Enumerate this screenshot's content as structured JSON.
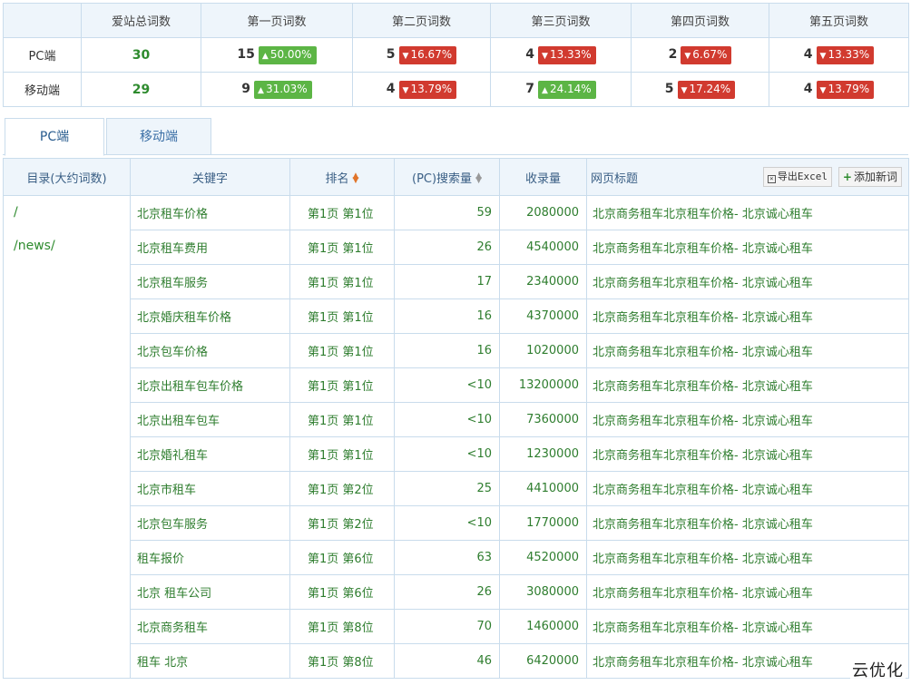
{
  "summary": {
    "headers": [
      "",
      "爱站总词数",
      "第一页词数",
      "第二页词数",
      "第三页词数",
      "第四页词数",
      "第五页词数"
    ],
    "rows": [
      {
        "label": "PC端",
        "total": "30",
        "pages": [
          {
            "count": "15",
            "pct": "50.00%",
            "dir": "up"
          },
          {
            "count": "5",
            "pct": "16.67%",
            "dir": "down"
          },
          {
            "count": "4",
            "pct": "13.33%",
            "dir": "down"
          },
          {
            "count": "2",
            "pct": "6.67%",
            "dir": "down"
          },
          {
            "count": "4",
            "pct": "13.33%",
            "dir": "down"
          }
        ]
      },
      {
        "label": "移动端",
        "total": "29",
        "pages": [
          {
            "count": "9",
            "pct": "31.03%",
            "dir": "up"
          },
          {
            "count": "4",
            "pct": "13.79%",
            "dir": "down"
          },
          {
            "count": "7",
            "pct": "24.14%",
            "dir": "up"
          },
          {
            "count": "5",
            "pct": "17.24%",
            "dir": "down"
          },
          {
            "count": "4",
            "pct": "13.79%",
            "dir": "down"
          }
        ]
      }
    ]
  },
  "tabs": [
    {
      "label": "PC端",
      "active": true
    },
    {
      "label": "移动端",
      "active": false
    }
  ],
  "table": {
    "headers": {
      "dir": "目录(大约词数)",
      "keyword": "关键字",
      "rank": "排名",
      "search_volume": "(PC)搜索量",
      "indexed": "收录量",
      "page_title": "网页标题"
    },
    "buttons": {
      "export": "导出Excel",
      "add": "添加新词"
    },
    "directories": [
      "/",
      "/news/"
    ],
    "rows": [
      {
        "keyword": "北京租车价格",
        "rank": "第1页 第1位",
        "volume": "59",
        "indexed": "2080000",
        "title": "北京商务租车北京租车价格- 北京诚心租车"
      },
      {
        "keyword": "北京租车费用",
        "rank": "第1页 第1位",
        "volume": "26",
        "indexed": "4540000",
        "title": "北京商务租车北京租车价格- 北京诚心租车"
      },
      {
        "keyword": "北京租车服务",
        "rank": "第1页 第1位",
        "volume": "17",
        "indexed": "2340000",
        "title": "北京商务租车北京租车价格- 北京诚心租车"
      },
      {
        "keyword": "北京婚庆租车价格",
        "rank": "第1页 第1位",
        "volume": "16",
        "indexed": "4370000",
        "title": "北京商务租车北京租车价格- 北京诚心租车"
      },
      {
        "keyword": "北京包车价格",
        "rank": "第1页 第1位",
        "volume": "16",
        "indexed": "1020000",
        "title": "北京商务租车北京租车价格- 北京诚心租车"
      },
      {
        "keyword": "北京出租车包车价格",
        "rank": "第1页 第1位",
        "volume": "<10",
        "indexed": "13200000",
        "title": "北京商务租车北京租车价格- 北京诚心租车"
      },
      {
        "keyword": "北京出租车包车",
        "rank": "第1页 第1位",
        "volume": "<10",
        "indexed": "7360000",
        "title": "北京商务租车北京租车价格- 北京诚心租车"
      },
      {
        "keyword": "北京婚礼租车",
        "rank": "第1页 第1位",
        "volume": "<10",
        "indexed": "1230000",
        "title": "北京商务租车北京租车价格- 北京诚心租车"
      },
      {
        "keyword": "北京市租车",
        "rank": "第1页 第2位",
        "volume": "25",
        "indexed": "4410000",
        "title": "北京商务租车北京租车价格- 北京诚心租车"
      },
      {
        "keyword": "北京包车服务",
        "rank": "第1页 第2位",
        "volume": "<10",
        "indexed": "1770000",
        "title": "北京商务租车北京租车价格- 北京诚心租车"
      },
      {
        "keyword": "租车报价",
        "rank": "第1页 第6位",
        "volume": "63",
        "indexed": "4520000",
        "title": "北京商务租车北京租车价格- 北京诚心租车"
      },
      {
        "keyword": "北京 租车公司",
        "rank": "第1页 第6位",
        "volume": "26",
        "indexed": "3080000",
        "title": "北京商务租车北京租车价格- 北京诚心租车"
      },
      {
        "keyword": "北京商务租车",
        "rank": "第1页 第8位",
        "volume": "70",
        "indexed": "1460000",
        "title": "北京商务租车北京租车价格- 北京诚心租车"
      },
      {
        "keyword": "租车 北京",
        "rank": "第1页 第8位",
        "volume": "46",
        "indexed": "6420000",
        "title": "北京商务租车北京租车价格- 北京诚心租车"
      }
    ]
  },
  "watermark": "云优化",
  "colors": {
    "up": "#5cb545",
    "down": "#d13a2f",
    "keyword_green": "#2e7d2e",
    "header_bg": "#eef5fb"
  }
}
